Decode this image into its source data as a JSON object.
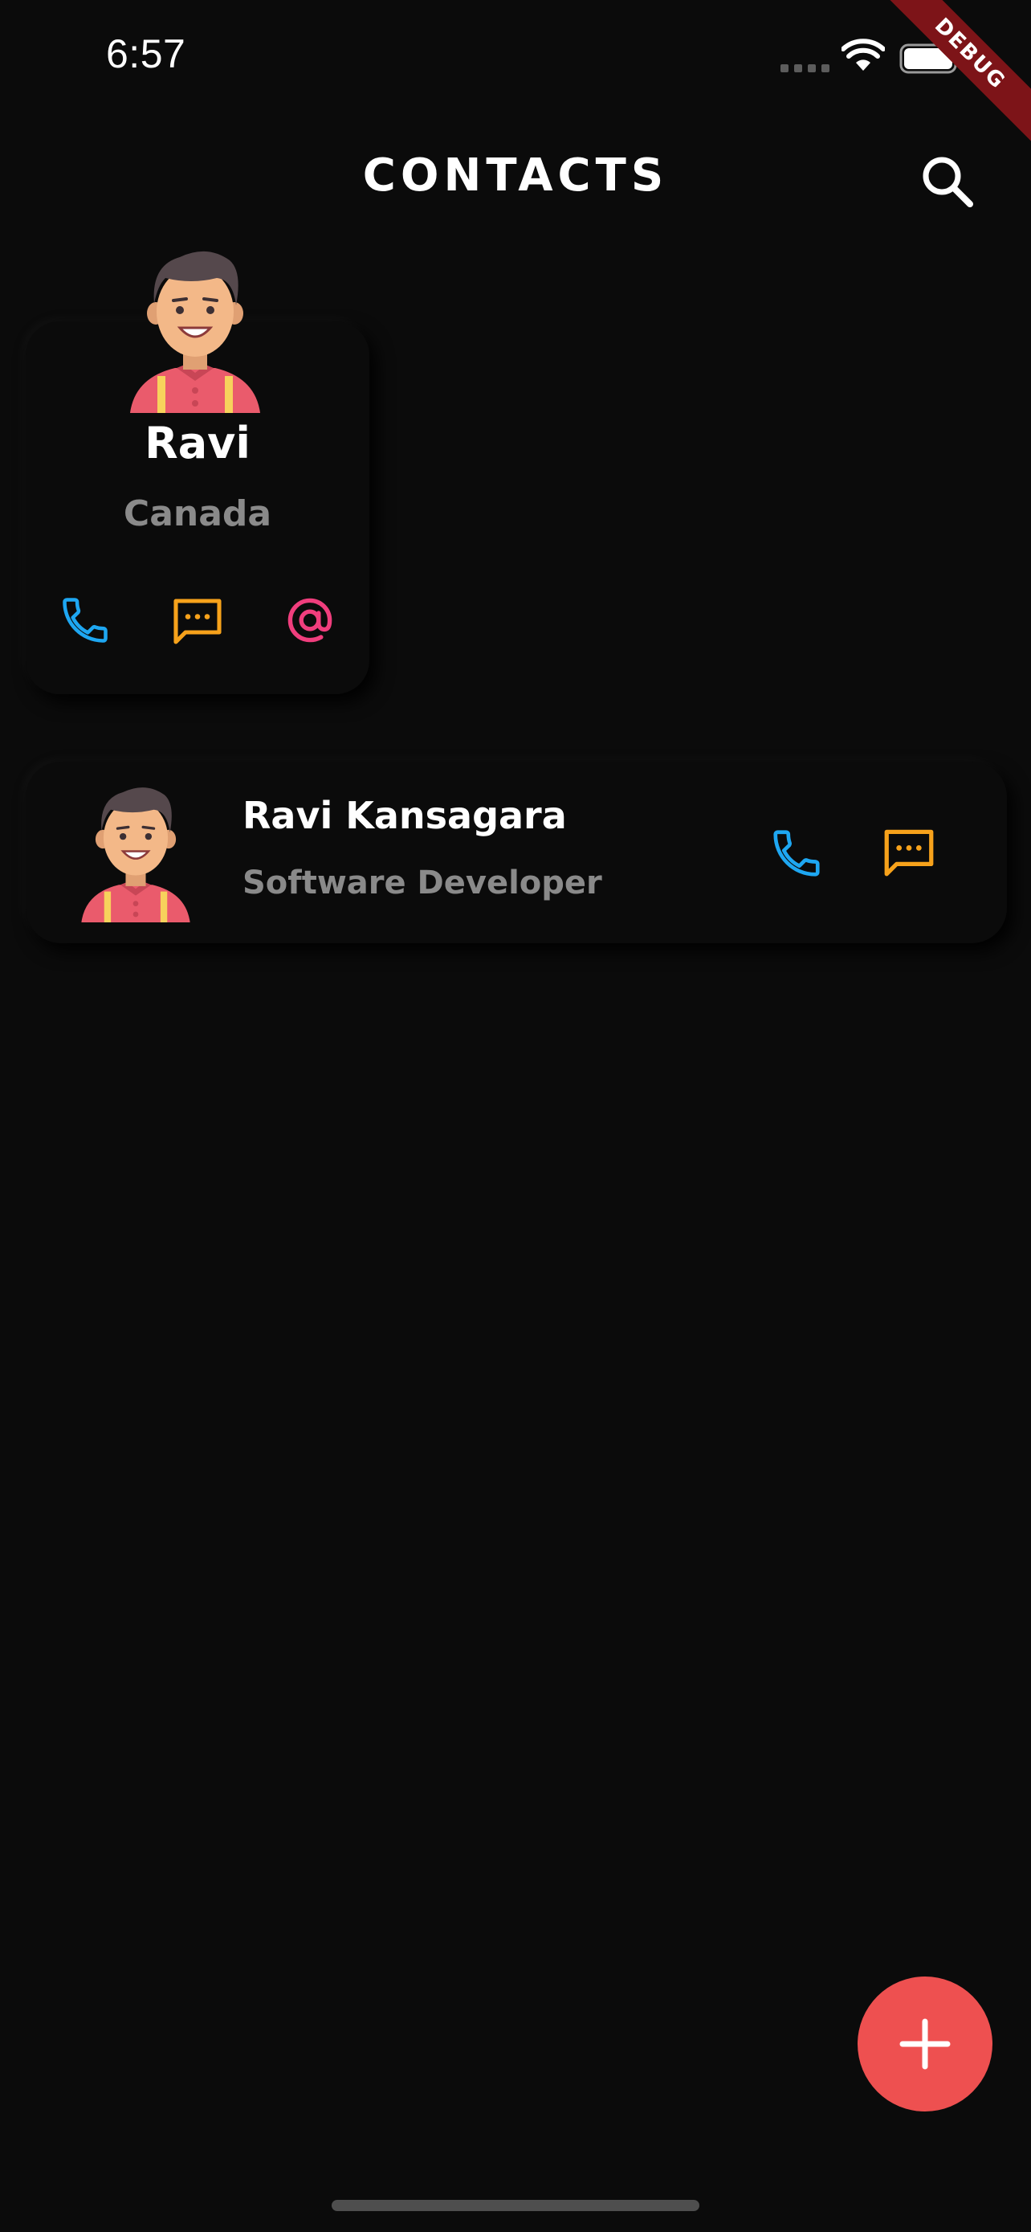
{
  "status_bar": {
    "time": "6:57"
  },
  "debug_banner": {
    "label": "DEBUG"
  },
  "header": {
    "title": "CONTACTS"
  },
  "contacts_grid": [
    {
      "name": "Ravi",
      "location": "Canada",
      "actions": [
        "phone-icon",
        "message-icon",
        "email-icon"
      ]
    }
  ],
  "contacts_list": [
    {
      "name": "Ravi Kansagara",
      "role": "Software Developer",
      "actions": [
        "phone-icon",
        "message-icon"
      ]
    }
  ],
  "colors": {
    "background": "#0b0b0b",
    "phone": "#1ea7f2",
    "message": "#f7a21b",
    "email": "#f03e7d",
    "fab": "#ee5050",
    "secondary_text": "#8a8a8a",
    "debug": "#7d1418"
  },
  "icons": {
    "search": "search-icon",
    "add": "plus-icon"
  }
}
